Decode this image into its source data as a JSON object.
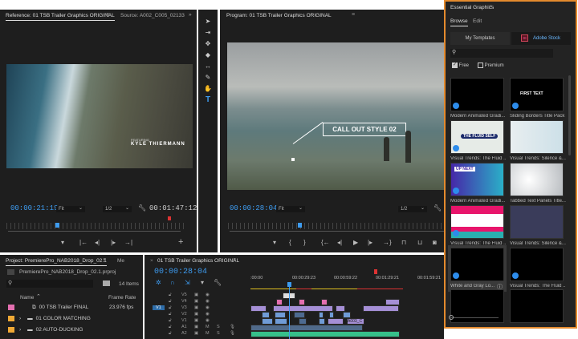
{
  "source_monitor": {
    "tabs": [
      "Reference: 01 TSB Trailer Graphics ORIGINAL",
      "Source: A002_C005_02133"
    ],
    "overflow": "»",
    "video_overlay": {
      "small": "FEATURING",
      "name": "KYLE THIERMANN"
    },
    "timecode": "00:00:21:19",
    "zoom": "Fit",
    "resolution": "1/2",
    "duration": "00:01:47:12"
  },
  "program_monitor": {
    "title": "Program: 01 TSB Trailer Graphics ORIGINAL",
    "callout": "CALL OUT STYLE 02",
    "timecode": "00:00:28:04",
    "zoom": "Fit",
    "resolution": "1/2"
  },
  "essential_graphics": {
    "title": "Essential Graphics",
    "tabs": [
      "Browse",
      "Edit"
    ],
    "source_buttons": [
      "My Templates",
      "Adobe Stock"
    ],
    "stock_icon": "St",
    "filters": [
      {
        "label": "Free",
        "checked": true
      },
      {
        "label": "Premium",
        "checked": false
      }
    ],
    "templates": [
      {
        "label": "Modern Animated Gradi..."
      },
      {
        "label": "Sliding Borders Title Pack",
        "thumb_text": "FIRST TEXT"
      },
      {
        "label": "Visual Trends: The Fluid ...",
        "thumb_text": "THE FLUID SELF"
      },
      {
        "label": "Visual Trends: Silence &..."
      },
      {
        "label": "Modern Animated Gradi...",
        "thumb_text": "UP NEXT"
      },
      {
        "label": "Tabbed Text Panels Title..."
      },
      {
        "label": "Visual Trends: The Fluid ..."
      },
      {
        "label": "Visual Trends: Silence &..."
      },
      {
        "label": "White and Gray Lo..."
      },
      {
        "label": "Visual Trends: The Fluid ..."
      },
      {
        "label": ""
      },
      {
        "label": ""
      }
    ]
  },
  "project": {
    "tabs": [
      "Project: PremierePro_NAB2018_Drop_02.1",
      "Me"
    ],
    "file": "PremierePro_NAB2018_Drop_02.1.prproj",
    "items_count": "14 Items",
    "columns": [
      "Name",
      "Frame Rate"
    ],
    "rows": [
      {
        "name": "00 TSB Trailer FINAL",
        "rate": "23.976 fps",
        "color": "#e46fb0"
      },
      {
        "name": "01 COLOR MATCHING",
        "rate": "",
        "color": "#f0a935"
      },
      {
        "name": "02 AUTO-DUCKING",
        "rate": "",
        "color": "#f0a935"
      }
    ]
  },
  "timeline": {
    "title": "01 TSB Trailer Graphics ORIGINAL",
    "timecode": "00:00:28:04",
    "ruler": [
      ":00:00",
      "00:00:29:23",
      "00:00:59:22",
      "00:01:29:21",
      "00:01:59:21"
    ],
    "video_tracks": [
      "V5",
      "V4",
      "V3",
      "V2",
      "V1"
    ],
    "audio_tracks": [
      "A1",
      "A2"
    ],
    "active_track": "V1",
    "m": "M",
    "s": "S",
    "clip_label": "A003_C"
  },
  "colors": {
    "accent": "#3d9bef",
    "panel_border": "#e48a2d",
    "clip_purple": "#a58fd6",
    "clip_blue": "#6f9bd6",
    "clip_pink": "#e46fb0",
    "clip_green": "#36c08a"
  }
}
